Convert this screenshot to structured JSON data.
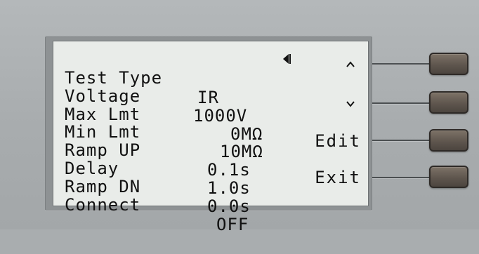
{
  "display": {
    "rows": [
      {
        "label": "Test Type",
        "value": "IR"
      },
      {
        "label": "Voltage",
        "value": "1000V"
      },
      {
        "label": "Max Lmt",
        "value": "0MΩ"
      },
      {
        "label": "Min Lmt",
        "value": "10MΩ"
      },
      {
        "label": "Ramp UP",
        "value": "0.1s"
      },
      {
        "label": "Delay",
        "value": "1.0s"
      },
      {
        "label": "Ramp DN",
        "value": "0.0s"
      },
      {
        "label": "Connect",
        "value": "OFF"
      }
    ],
    "cursor_icon": "left-triangle-cursor-icon"
  },
  "softkeys": {
    "up_icon": "chevron-up-icon",
    "down_icon": "chevron-down-icon",
    "edit_label": "Edit",
    "exit_label": "Exit"
  },
  "colors": {
    "lcd_background": "#e9ece9",
    "lcd_text": "#111111",
    "panel": "#a9adaf",
    "button": "#5f564e"
  }
}
